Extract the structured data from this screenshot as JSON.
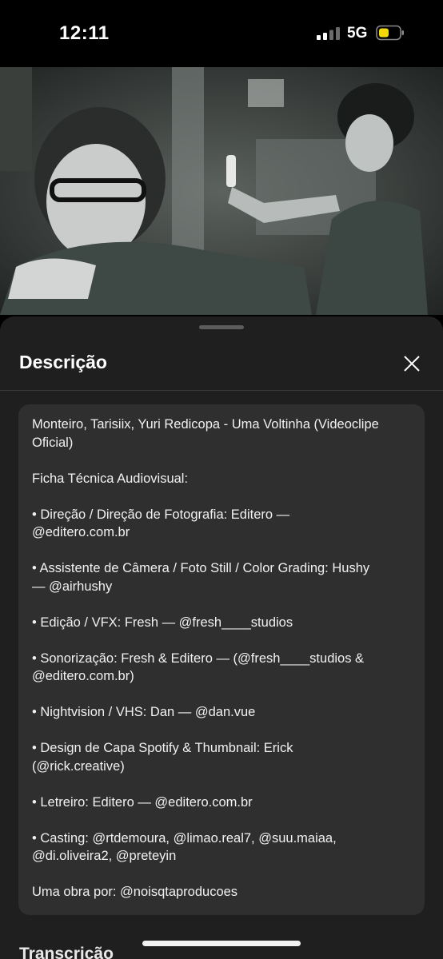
{
  "status_bar": {
    "time": "12:11",
    "network": "5G",
    "battery_color": "#f5d90a"
  },
  "sheet": {
    "title": "Descrição",
    "close_icon": "close-icon"
  },
  "description": {
    "lines": [
      "Monteiro, Tarisiix, Yuri Redicopa - Uma Voltinha (Videoclipe",
      "Oficial)",
      "",
      "Ficha Técnica Audiovisual:",
      "",
      "• Direção / Direção de Fotografia: Editero —",
      "@editero.com.br",
      "",
      "• Assistente de Câmera / Foto Still / Color Grading: Hushy",
      "— @airhushy",
      "",
      "• Edição / VFX: Fresh — @fresh____studios",
      "",
      "• Sonorização: Fresh & Editero — (@fresh____studios &",
      "@editero.com.br)",
      "",
      "• Nightvision / VHS: Dan — @dan.vue",
      "",
      "• Design de Capa Spotify & Thumbnail: Erick",
      "(@rick.creative)",
      "",
      "• Letreiro: Editero — @editero.com.br",
      "",
      "• Casting: @rtdemoura, @limao.real7, @suu.maiaa,",
      "@di.oliveira2, @preteyin",
      "",
      "Uma obra por: @noisqtaproducoes"
    ]
  },
  "next_section_title": "Transcrição"
}
